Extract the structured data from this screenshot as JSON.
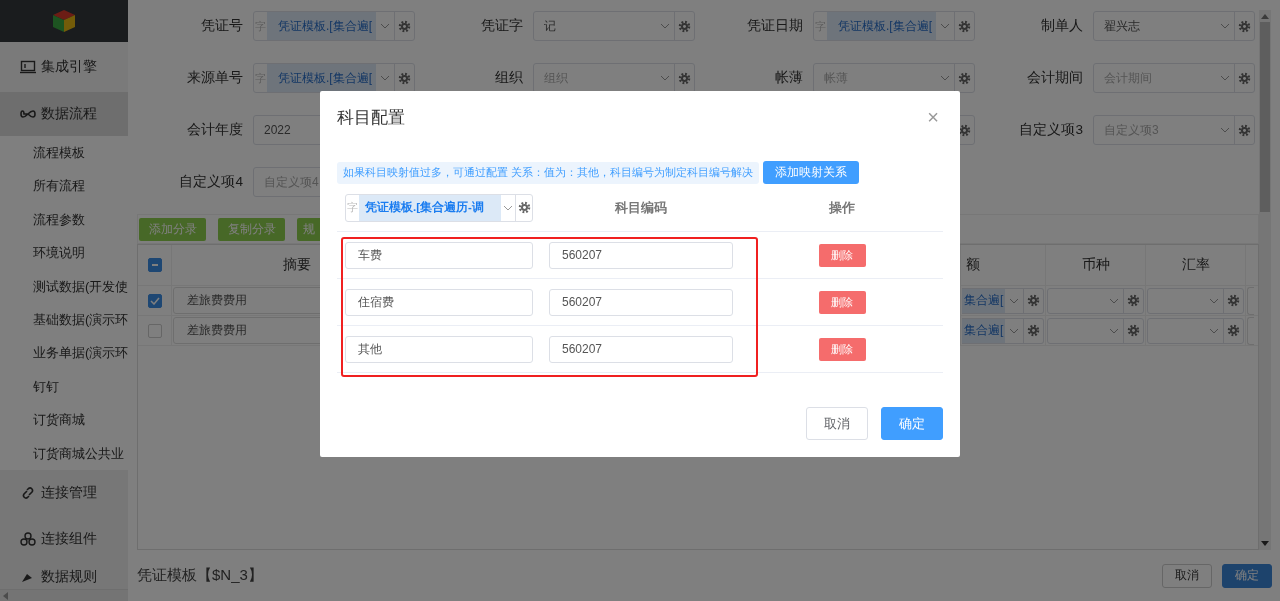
{
  "sidebar": {
    "items": [
      {
        "label": "集成引擎",
        "expanded": false
      },
      {
        "label": "数据流程",
        "expanded": true,
        "children": [
          {
            "label": "流程模板"
          },
          {
            "label": "所有流程"
          },
          {
            "label": "流程参数"
          },
          {
            "label": "环境说明"
          },
          {
            "label": "测试数据(开发使"
          },
          {
            "label": "基础数据(演示环"
          },
          {
            "label": "业务单据(演示环"
          },
          {
            "label": "钉钉"
          },
          {
            "label": "订货商城"
          },
          {
            "label": "订货商城公共业"
          }
        ]
      },
      {
        "label": "连接管理",
        "expanded": false
      },
      {
        "label": "连接组件",
        "expanded": false
      },
      {
        "label": "数据规则",
        "expanded": false
      }
    ]
  },
  "form": {
    "rows": [
      [
        {
          "label": "凭证号",
          "kind": "template",
          "prefix": "字",
          "value": "凭证模板.[集合遍["
        },
        {
          "label": "凭证字",
          "kind": "select",
          "value": "记"
        },
        {
          "label": "凭证日期",
          "kind": "template",
          "prefix": "字",
          "value": "凭证模板.[集合遍["
        },
        {
          "label": "制单人",
          "kind": "select",
          "value": "翟兴志"
        }
      ],
      [
        {
          "label": "来源单号",
          "kind": "template",
          "prefix": "字",
          "value": "凭证模板.[集合遍["
        },
        {
          "label": "组织",
          "kind": "select",
          "placeholder": "组织"
        },
        {
          "label": "帐薄",
          "kind": "select",
          "placeholder": "帐薄"
        },
        {
          "label": "会计期间",
          "kind": "select",
          "placeholder": "会计期间"
        }
      ],
      [
        {
          "label": "会计年度",
          "kind": "select",
          "value": "2022"
        },
        null,
        {
          "kind": "select"
        },
        {
          "label": "自定义项3",
          "kind": "select",
          "placeholder": "自定义项3"
        }
      ],
      [
        {
          "label": "自定义项4",
          "kind": "select",
          "placeholder": "自定义项4"
        }
      ]
    ]
  },
  "toolbar": {
    "buttons": [
      "添加分录",
      "复制分录",
      "规"
    ]
  },
  "table": {
    "header_indeterminate": true,
    "columns": [
      "摘要",
      "额",
      "币种",
      "汇率"
    ],
    "rows": [
      {
        "selected": true,
        "summary": "差旅费费用",
        "amount": "集合遍["
      },
      {
        "selected": false,
        "summary": "差旅费费用",
        "amount": "集合遍["
      }
    ]
  },
  "footer": {
    "title": "凭证模板【$N_3】",
    "buttons": [
      "取消",
      "确定"
    ]
  },
  "dialog": {
    "title": "科目配置",
    "close": "×",
    "tip": "如果科目映射值过多，可通过配置 关系：值为：其他，科目编号为制定科目编号解决",
    "add_button": "添加映射关系",
    "header": {
      "prefix": "字",
      "template": "凭证模板.[集合遍历-调",
      "code": "科目编码",
      "action": "操作"
    },
    "rows": [
      {
        "name": "车费",
        "code": "560207",
        "action": "删除"
      },
      {
        "name": "住宿费",
        "code": "560207",
        "action": "删除"
      },
      {
        "name": "其他",
        "code": "560207",
        "action": "删除"
      }
    ],
    "buttons": [
      "取消",
      "确定"
    ]
  }
}
